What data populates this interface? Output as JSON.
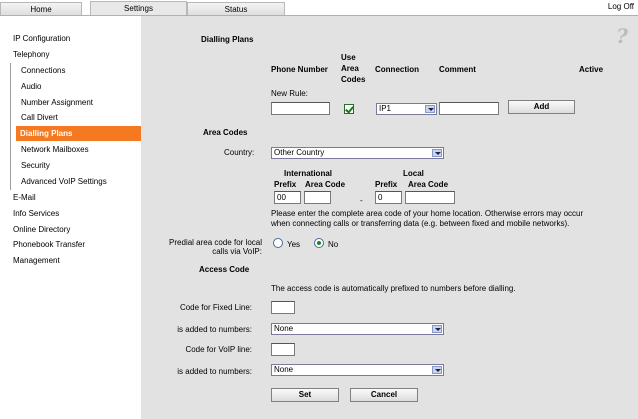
{
  "tabs": [
    "Home",
    "Settings",
    "Status"
  ],
  "logoff": "Log Off",
  "sidebar": {
    "items": [
      {
        "label": "IP Configuration"
      },
      {
        "label": "Telephony"
      },
      {
        "label": "Connections"
      },
      {
        "label": "Audio"
      },
      {
        "label": "Number Assignment"
      },
      {
        "label": "Call Divert"
      },
      {
        "label": "Dialling Plans"
      },
      {
        "label": "Network Mailboxes"
      },
      {
        "label": "Security"
      },
      {
        "label": "Advanced VoIP Settings"
      },
      {
        "label": "E-Mail"
      },
      {
        "label": "Info Services"
      },
      {
        "label": "Online Directory"
      },
      {
        "label": "Phonebook Transfer"
      },
      {
        "label": "Management"
      }
    ]
  },
  "help": "?",
  "dialling": {
    "title": "Dialling Plans",
    "col_phone": "Phone Number",
    "col_use1": "Use",
    "col_use2": "Area",
    "col_use3": "Codes",
    "col_connection": "Connection",
    "col_comment": "Comment",
    "col_active": "Active",
    "new_rule": "New Rule:",
    "phone_value": "",
    "use_area_codes": true,
    "connection_value": "IP1",
    "comment_value": "",
    "add_label": "Add"
  },
  "area": {
    "title": "Area Codes",
    "country_label": "Country:",
    "country_value": "Other Country",
    "intl": "International",
    "local": "Local",
    "prefix": "Prefix",
    "area_code": "Area Code",
    "intl_prefix": "00",
    "intl_area": "",
    "dash": "-",
    "local_prefix": "0",
    "local_area": "",
    "note1": "Please enter the complete area code of your home location. Otherwise errors may occur",
    "note2": "when connecting calls or transferring data (e.g. between fixed and mobile networks).",
    "predial1": "Predial area code for local",
    "predial2": "calls via VoIP:",
    "yes": "Yes",
    "no": "No",
    "predial_selected": "No"
  },
  "access": {
    "title": "Access Code",
    "note": "The access code is automatically prefixed to numbers before dialling.",
    "fixed_label": "Code for Fixed Line:",
    "fixed_value": "",
    "added1_label": "is added to numbers:",
    "added1_value": "None",
    "voip_label": "Code for VoIP line:",
    "voip_value": "",
    "added2_label": "is added to numbers:",
    "added2_value": "None"
  },
  "buttons": {
    "set": "Set",
    "cancel": "Cancel"
  }
}
